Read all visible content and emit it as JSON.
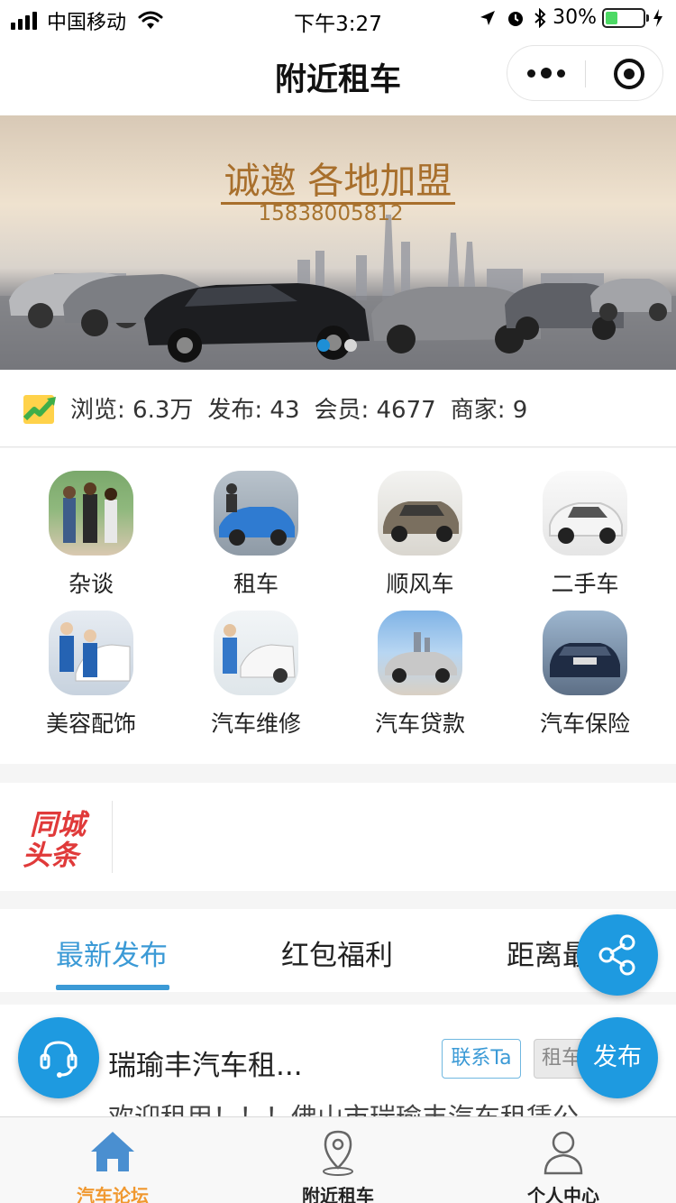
{
  "status_bar": {
    "carrier": "中国移动",
    "time": "下午3:27",
    "battery_percent": "30%"
  },
  "nav": {
    "title": "附近租车"
  },
  "banner": {
    "headline": "诚邀 各地加盟",
    "phone": "15838005812",
    "slide_count": 2,
    "active_slide": 1
  },
  "stats": {
    "views": "浏览: 6.3万",
    "posts": "发布: 43",
    "members": "会员: 4677",
    "merchants": "商家: 9"
  },
  "categories": [
    {
      "label": "杂谈",
      "icon": "people-photo"
    },
    {
      "label": "租车",
      "icon": "rental-car-photo"
    },
    {
      "label": "顺风车",
      "icon": "minivan-photo"
    },
    {
      "label": "二手车",
      "icon": "used-car-photo"
    },
    {
      "label": "美容配饰",
      "icon": "detailing-photo"
    },
    {
      "label": "汽车维修",
      "icon": "repair-photo"
    },
    {
      "label": "汽车贷款",
      "icon": "loan-car-photo"
    },
    {
      "label": "汽车保险",
      "icon": "insurance-car-photo"
    }
  ],
  "headline": {
    "logo_line1": "同城",
    "logo_line2": "头条"
  },
  "feed_tabs": {
    "items": [
      "最新发布",
      "红包福利",
      "距离最"
    ],
    "active_index": 0
  },
  "feed": {
    "items": [
      {
        "title": "瑞瑜丰汽车租...",
        "contact_label": "联系Ta",
        "tag": "租车",
        "desc": "欢迎租用！！！佛山市瑞瑜丰汽车租赁公"
      }
    ]
  },
  "fabs": {
    "publish_label": "发布"
  },
  "tab_bar": {
    "items": [
      {
        "label": "汽车论坛",
        "icon": "home-icon",
        "active": true
      },
      {
        "label": "附近租车",
        "icon": "location-pin-icon",
        "active": false
      },
      {
        "label": "个人中心",
        "icon": "person-icon",
        "active": false
      }
    ]
  },
  "colors": {
    "accent": "#3b9ad6",
    "fab": "#1e9ae0",
    "tab_active": "#f0982f",
    "banner_gold": "#a86f2c",
    "logo_red": "#e03a3a"
  }
}
